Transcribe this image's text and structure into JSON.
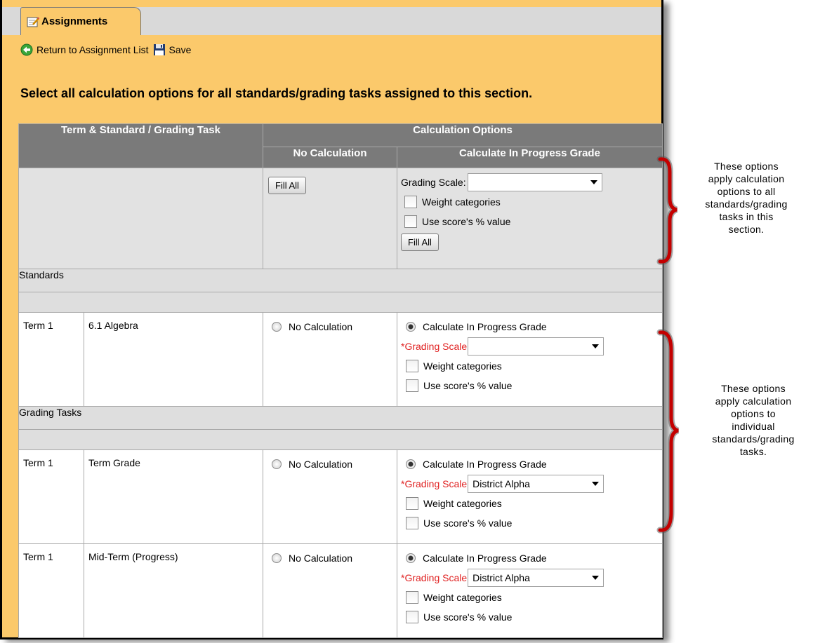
{
  "tab": {
    "label": "Assignments",
    "icon": "notepad-pencil-icon"
  },
  "toolbar": {
    "return_label": "Return to Assignment List",
    "return_icon": "green-back-arrow-icon",
    "save_label": "Save",
    "save_icon": "floppy-disk-icon"
  },
  "heading": "Select all calculation options for all standards/grading tasks assigned to this section.",
  "table": {
    "col_term_standard": "Term & Standard / Grading Task",
    "col_calc_options": "Calculation Options",
    "col_no_calc": "No Calculation",
    "col_calc_in_progress": "Calculate In Progress Grade"
  },
  "bulk": {
    "fill_all_no_calc": "Fill All",
    "grading_scale_label": "Grading Scale:",
    "grading_scale_value": "",
    "weight_label": "Weight categories",
    "score_label": "Use score's % value",
    "fill_all_calc": "Fill All"
  },
  "sections": {
    "standards": "Standards",
    "grading_tasks": "Grading Tasks"
  },
  "rows": [
    {
      "term": "Term 1",
      "name": "6.1 Algebra",
      "no_calc_label": "No Calculation",
      "calc_label": "Calculate In Progress Grade",
      "scale_label": "*Grading Scale",
      "scale_value": "",
      "weight_label": "Weight categories",
      "score_label": "Use score's % value",
      "selected": "calc"
    },
    {
      "term": "Term 1",
      "name": "Term Grade",
      "no_calc_label": "No Calculation",
      "calc_label": "Calculate In Progress Grade",
      "scale_label": "*Grading Scale",
      "scale_value": "District Alpha",
      "weight_label": "Weight categories",
      "score_label": "Use score's % value",
      "selected": "calc"
    },
    {
      "term": "Term 1",
      "name": "Mid-Term (Progress)",
      "no_calc_label": "No Calculation",
      "calc_label": "Calculate In Progress Grade",
      "scale_label": "*Grading Scale",
      "scale_value": "District Alpha",
      "weight_label": "Weight categories",
      "score_label": "Use score's % value",
      "selected": "calc"
    }
  ],
  "annotations": {
    "top": [
      "These options",
      "apply calculation",
      "options to all",
      "standards/grading",
      "tasks in this",
      "section."
    ],
    "bottom": [
      "These options",
      "apply calculation",
      "options to",
      "individual",
      "standards/grading",
      "tasks."
    ],
    "bracket_color": "#c40000"
  },
  "colors": {
    "panel": "#fbc96b",
    "header": "#7a7a7a",
    "section": "#dedede",
    "required": "#e02020"
  }
}
